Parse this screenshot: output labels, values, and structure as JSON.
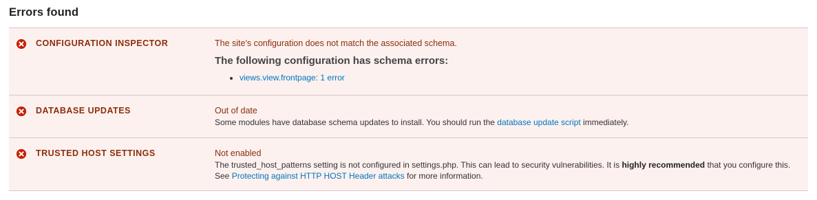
{
  "section_title": "Errors found",
  "rows": [
    {
      "title": "CONFIGURATION INSPECTOR",
      "status": "The site's configuration does not match the associated schema.",
      "subheading": "The following configuration has schema errors:",
      "list": [
        {
          "link_text": "views.view.frontpage: 1 error"
        }
      ]
    },
    {
      "title": "DATABASE UPDATES",
      "status": "Out of date",
      "desc_before": "Some modules have database schema updates to install. You should run the ",
      "link_text": "database update script",
      "desc_after": " immediately."
    },
    {
      "title": "TRUSTED HOST SETTINGS",
      "status": "Not enabled",
      "desc_before": "The trusted_host_patterns setting is not configured in settings.php. This can lead to security vulnerabilities. It is ",
      "desc_bold": "highly recommended",
      "desc_middle": " that you configure this. See ",
      "link_text": "Protecting against HTTP HOST Header attacks",
      "desc_after": " for more information."
    }
  ],
  "colors": {
    "error_red": "#c72000",
    "title_brown": "#8c2e0b",
    "row_bg": "#fcf1ef",
    "link_blue": "#0074bd"
  },
  "icons": {
    "status": "error-circle-icon"
  }
}
